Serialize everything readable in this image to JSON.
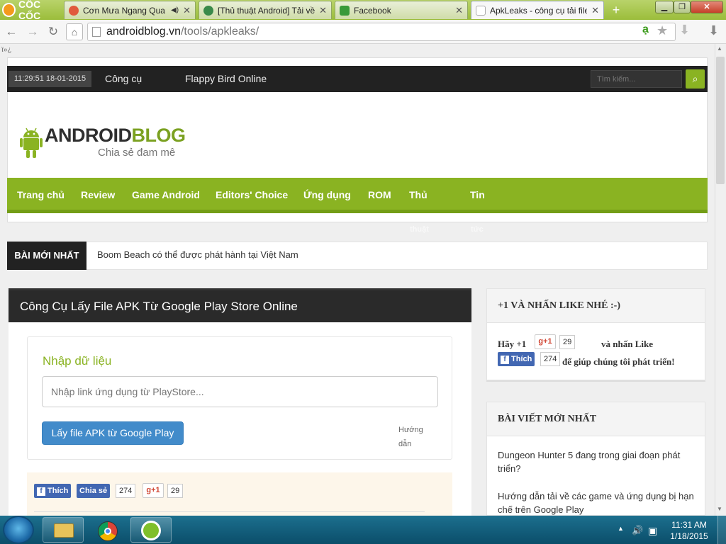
{
  "browser": {
    "logo": "CỐC CỐC",
    "tabs": [
      {
        "title": "Cơn Mưa Ngang Qua (F",
        "color": "#e05a3c",
        "mute": "◀)"
      },
      {
        "title": "[Thủ thuật Android] Tải về",
        "color": "#3a8a4a"
      },
      {
        "title": "Facebook",
        "color": "#3a9a3a"
      },
      {
        "title": "ApkLeaks - công cụ tải file",
        "color": "#ffffff"
      }
    ],
    "url_host": "androidblog.vn",
    "url_path": "/tools/apkleaks/"
  },
  "page": {
    "glyph": "ï»¿",
    "clock": "11:29:51 18-01-2015",
    "topnav": [
      "Công cụ",
      "Flappy Bird Online"
    ],
    "search_placeholder": "Tìm kiếm...",
    "brand": {
      "name_a": "ANDROID",
      "name_b": "BLOG",
      "tagline": "Chia sẻ đam mê"
    },
    "nav": {
      "items": [
        "Trang chủ",
        "Review",
        "Game Android",
        "Editors' Choice",
        "Ứng dụng",
        "ROM",
        "Thủ",
        "Tin"
      ],
      "wrap": [
        "thuật",
        "tức"
      ]
    },
    "breaking": {
      "label": "BÀI MỚI NHẤT",
      "text": "Boom Beach có thể được phát hành tại Việt Nam"
    },
    "post": {
      "title": "Công Cụ Lấy File APK Từ Google Play Store Online",
      "form_title": "Nhập dữ liệu",
      "input_placeholder": "Nhập link ứng dụng từ PlayStore...",
      "button": "Lấy file APK từ Google Play",
      "guide": "Hướng dẫn",
      "share": {
        "like": "Thích",
        "share": "Chia sẻ",
        "fb_count": "274",
        "gplus": "g+1",
        "gplus_count": "29"
      }
    },
    "sidebar": {
      "like_widget": {
        "title": "+1 VÀ NHẤN LIKE NHÉ :-)",
        "hay": "Hãy +1",
        "gplus": "g+1",
        "gplus_count": "29",
        "and_like": "và nhấn Like",
        "like": "Thích",
        "fb_count": "274",
        "help": "để giúp chúng tôi phát triển!"
      },
      "recent": {
        "title": "BÀI VIẾT MỚI NHẤT",
        "posts": [
          "Dungeon Hunter 5 đang trong giai đoạn phát triển?",
          "Hướng dẫn tải về các game và ứng dụng bị hạn chế trên Google Play"
        ]
      }
    }
  },
  "taskbar": {
    "time": "11:31 AM",
    "date": "1/18/2015"
  }
}
